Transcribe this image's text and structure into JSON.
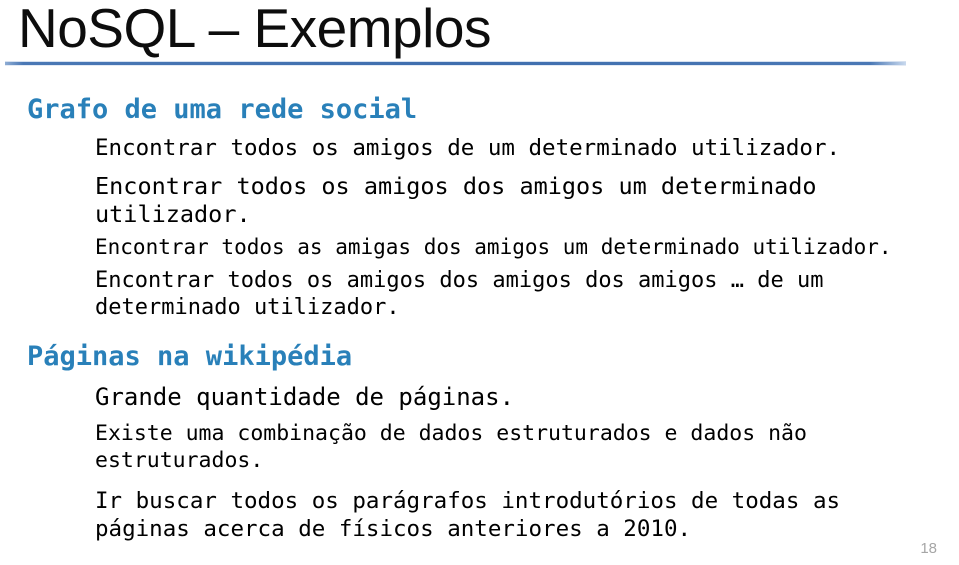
{
  "slide": {
    "title": "NoSQL – Exemplos",
    "number": "18",
    "accent_color": "#2980b9",
    "rule_color": "#3f6eae",
    "title_color": "#0d0d0d",
    "body_color": "#000000",
    "number_color": "#a6a6a6",
    "background_color": "#ffffff"
  },
  "sections": [
    {
      "heading": "Grafo de uma rede social",
      "bullets": [
        "Encontrar todos os amigos de um determinado utilizador.",
        "Encontrar todos os amigos dos amigos um determinado utilizador.",
        "Encontrar todos as amigas dos amigos um determinado utilizador.",
        "Encontrar todos os amigos dos amigos dos amigos … de um determinado utilizador."
      ]
    },
    {
      "heading": "Páginas na wikipédia",
      "bullets": [
        "Grande quantidade de páginas.",
        "Existe uma combinação de dados estruturados e dados não estruturados.",
        "Ir buscar todos os parágrafos introdutórios de todas as páginas acerca de físicos anteriores a 2010."
      ]
    }
  ]
}
